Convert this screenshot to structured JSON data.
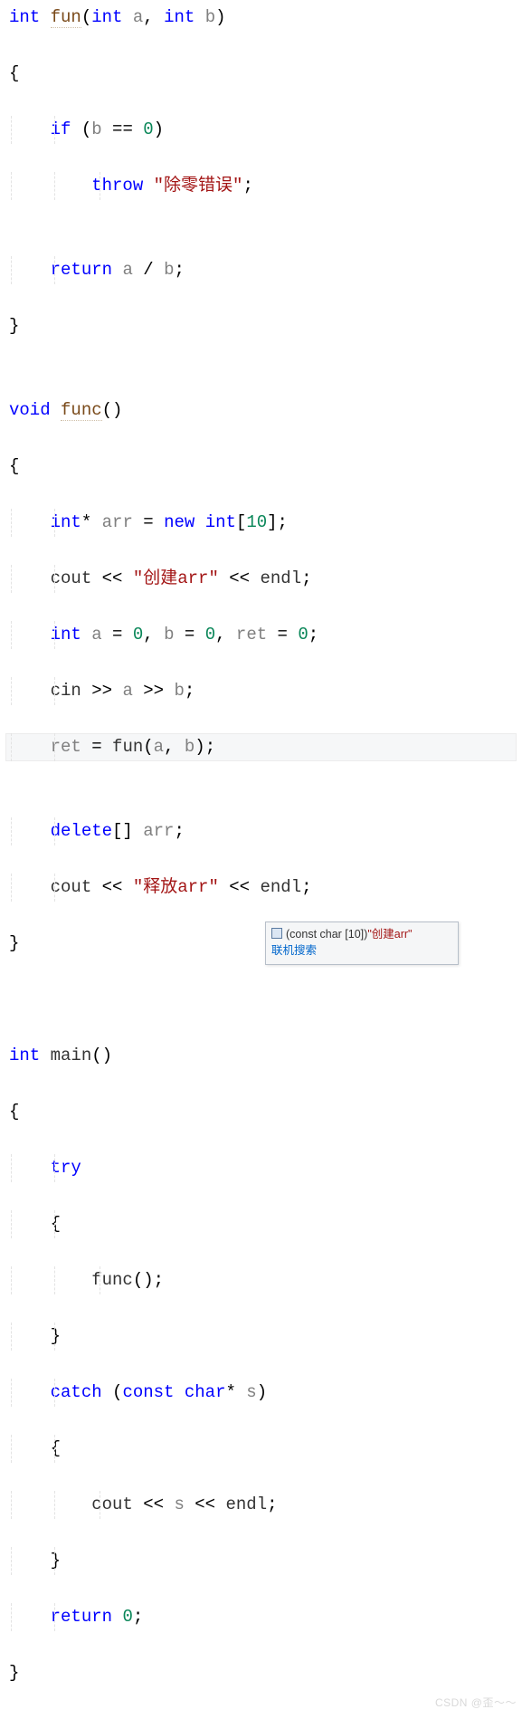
{
  "code": {
    "l1": {
      "kw": "int",
      "fn": "fun",
      "p1t": "int",
      "p1": "a",
      "p2t": "int",
      "p2": "b"
    },
    "l3": {
      "kw": "if",
      "cond_l": "b",
      "cond_op": "==",
      "cond_r": "0"
    },
    "l4": {
      "kw": "throw",
      "str": "\"除零错误\""
    },
    "l6": {
      "kw": "return",
      "a": "a",
      "op": "/",
      "b": "b"
    },
    "l9": {
      "kw": "void",
      "fn": "func"
    },
    "l11": {
      "t": "int",
      "name": "arr",
      "new": "new",
      "nt": "int",
      "sz": "10"
    },
    "l12": {
      "cout": "cout",
      "str": "\"创建arr\"",
      "endl": "endl"
    },
    "l13": {
      "t": "int",
      "a": "a",
      "av": "0",
      "b": "b",
      "bv": "0",
      "r": "ret",
      "rv": "0"
    },
    "l14": {
      "cin": "cin",
      "a": "a",
      "b": "b"
    },
    "l15": {
      "r": "ret",
      "fn": "fun",
      "a": "a",
      "b": "b"
    },
    "l17": {
      "kw": "delete",
      "arr": "arr"
    },
    "l18": {
      "cout": "cout",
      "str": "\"释放arr\"",
      "endl": "endl"
    },
    "l22": {
      "kw": "int",
      "fn": "main"
    },
    "l24": {
      "kw": "try"
    },
    "l26": {
      "fn": "func"
    },
    "l28": {
      "kw": "catch",
      "t": "const",
      "t2": "char",
      "p": "s"
    },
    "l30": {
      "cout": "cout",
      "s": "s",
      "endl": "endl"
    },
    "l32": {
      "kw": "return",
      "v": "0"
    }
  },
  "tooltip": {
    "type": "(const char [10])",
    "value": "\"创建arr\"",
    "link": "联机搜索"
  },
  "watermark": "CSDN @歪～～"
}
